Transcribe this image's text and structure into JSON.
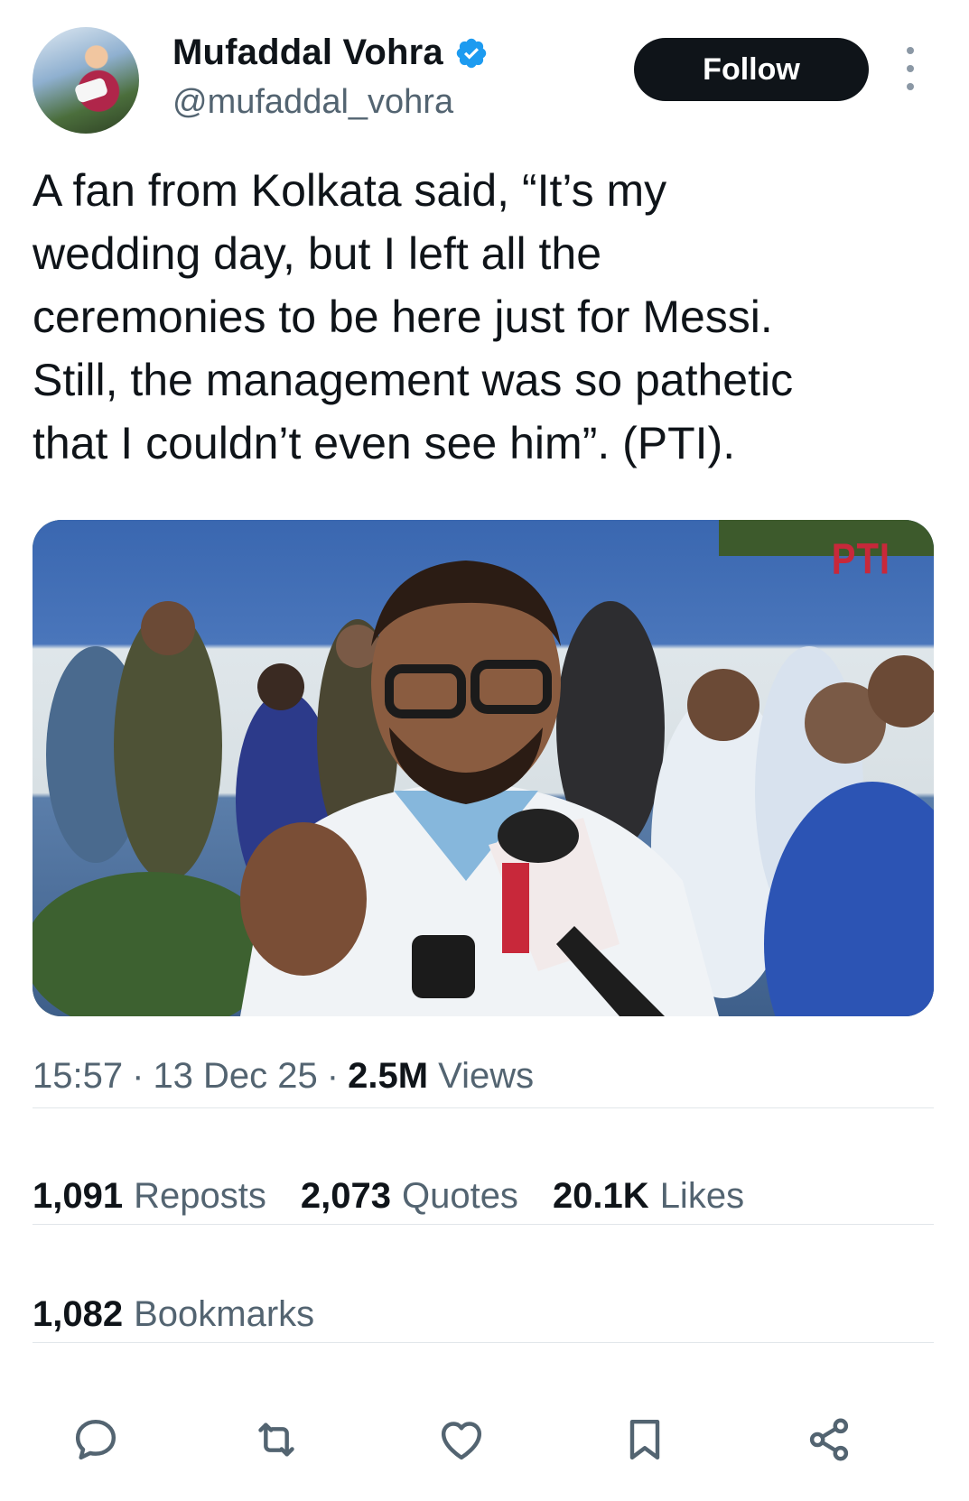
{
  "author": {
    "name": "Mufaddal Vohra",
    "handle": "@mufaddal_vohra",
    "verified_icon": "verified-badge-icon",
    "verified_color": "#1d9bf0"
  },
  "follow_label": "Follow",
  "more_icon": "more-options-icon",
  "tweet_text": "A fan from Kolkata said, “It’s my\nwedding day, but I left all the\nceremonies to be here just for Messi.\nStill, the management was so pathetic\nthat I couldn’t even see him”. (PTI).",
  "media": {
    "watermark": "PTI"
  },
  "meta": {
    "time": "15:57",
    "sep": "·",
    "date": "13 Dec 25",
    "views_count": "2.5M",
    "views_label": "Views"
  },
  "stats": {
    "reposts": {
      "num": "1,091",
      "label": "Reposts"
    },
    "quotes": {
      "num": "2,073",
      "label": "Quotes"
    },
    "likes": {
      "num": "20.1K",
      "label": "Likes"
    },
    "bookmarks": {
      "num": "1,082",
      "label": "Bookmarks"
    }
  },
  "actions": [
    "reply-icon",
    "repost-icon",
    "like-icon",
    "bookmark-icon",
    "share-icon"
  ],
  "colors": {
    "text": "#0f1419",
    "secondary": "#536471",
    "follow_bg": "#0f1419",
    "divider": "#e1e6ea"
  }
}
